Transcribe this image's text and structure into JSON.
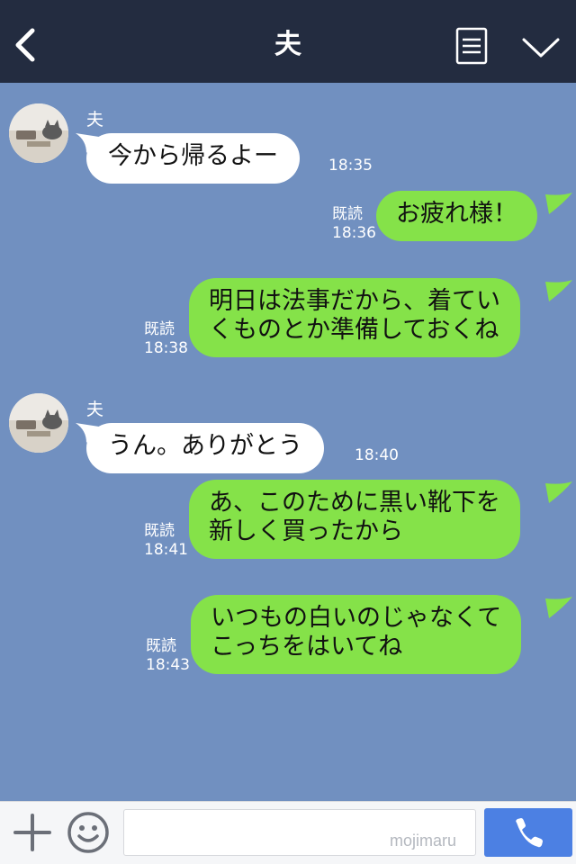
{
  "header": {
    "title": "夫"
  },
  "contact": {
    "name": "夫"
  },
  "messages": [
    {
      "side": "in",
      "text": "今から帰るよー",
      "time": "18:35"
    },
    {
      "side": "out",
      "text": "お疲れ様！",
      "read": "既読",
      "time": "18:36"
    },
    {
      "side": "out",
      "lines": [
        "明日は法事だから、着てい",
        "くものとか準備しておくね"
      ],
      "read": "既読",
      "time": "18:38"
    },
    {
      "side": "in",
      "text": "うん。ありがとう",
      "time": "18:40"
    },
    {
      "side": "out",
      "lines": [
        "あ、このために黒い靴下を",
        "新しく買ったから"
      ],
      "read": "既読",
      "time": "18:41"
    },
    {
      "side": "out",
      "lines": [
        "いつもの白いのじゃなくて",
        "こっちをはいてね"
      ],
      "read": "既読",
      "time": "18:43"
    }
  ],
  "input": {
    "placeholder": "",
    "watermark": "mojimaru"
  },
  "colors": {
    "header": "#232c40",
    "chat_bg": "#7190c0",
    "out_bubble": "#85e249",
    "in_bubble": "#ffffff",
    "call_button": "#4c80e3"
  },
  "icons": [
    "back-arrow-icon",
    "menu-list-icon",
    "chevron-down-icon",
    "plus-icon",
    "emoji-smiley-icon",
    "phone-icon"
  ]
}
